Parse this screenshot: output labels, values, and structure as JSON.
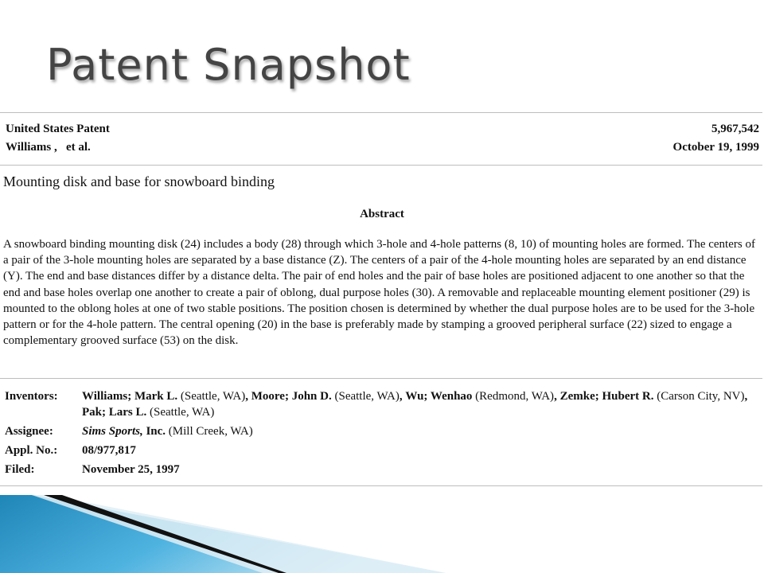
{
  "slide": {
    "title": "Patent Snapshot"
  },
  "patent": {
    "office": "United States Patent",
    "number": "5,967,542",
    "author": "Williams ,   et al.",
    "date": "October 19, 1999",
    "title": "Mounting disk and base for snowboard binding",
    "abstract_heading": "Abstract",
    "abstract": "A snowboard binding mounting disk (24) includes a body (28) through which 3-hole and 4-hole patterns (8, 10) of mounting holes are formed. The centers of a pair of the 3-hole mounting holes are separated by a base distance (Z). The centers of a pair of the 4-hole mounting holes are separated by an end distance (Y). The end and base distances differ by a distance delta. The pair of end holes and the pair of base holes are positioned adjacent to one another so that the end and base holes overlap one another to create a pair of oblong, dual purpose holes (30). A removable and replaceable mounting element positioner (29) is mounted to the oblong holes at one of two stable positions. The position chosen is determined by whether the dual purpose holes are to be used for the 3-hole pattern or for the 4-hole pattern. The central opening (20) in the base is preferably made by stamping a grooved peripheral surface (22) sized to engage a complementary grooved surface (53) on the disk."
  },
  "details": {
    "inventors_label": "Inventors:",
    "inventors": [
      {
        "name": "Williams; Mark L.",
        "location": "(Seattle, WA)"
      },
      {
        "name": "Moore; John D.",
        "location": "(Seattle, WA)"
      },
      {
        "name": "Wu; Wenhao",
        "location": "(Redmond, WA)"
      },
      {
        "name": "Zemke; Hubert R.",
        "location": "(Carson City, NV)"
      },
      {
        "name": "Pak; Lars L.",
        "location": "(Seattle, WA)"
      }
    ],
    "assignee_label": "Assignee:",
    "assignee_name": "Sims Sports,",
    "assignee_suffix": "Inc.",
    "assignee_location": "(Mill Creek, WA)",
    "appl_label": "Appl. No.:",
    "appl_no": "08/977,817",
    "filed_label": "Filed:",
    "filed": "November 25, 1997"
  },
  "colors": {
    "title": "#444444",
    "rule": "#bdbdbd",
    "accent_blue": "#3aa6d6",
    "accent_dark": "#111111"
  }
}
